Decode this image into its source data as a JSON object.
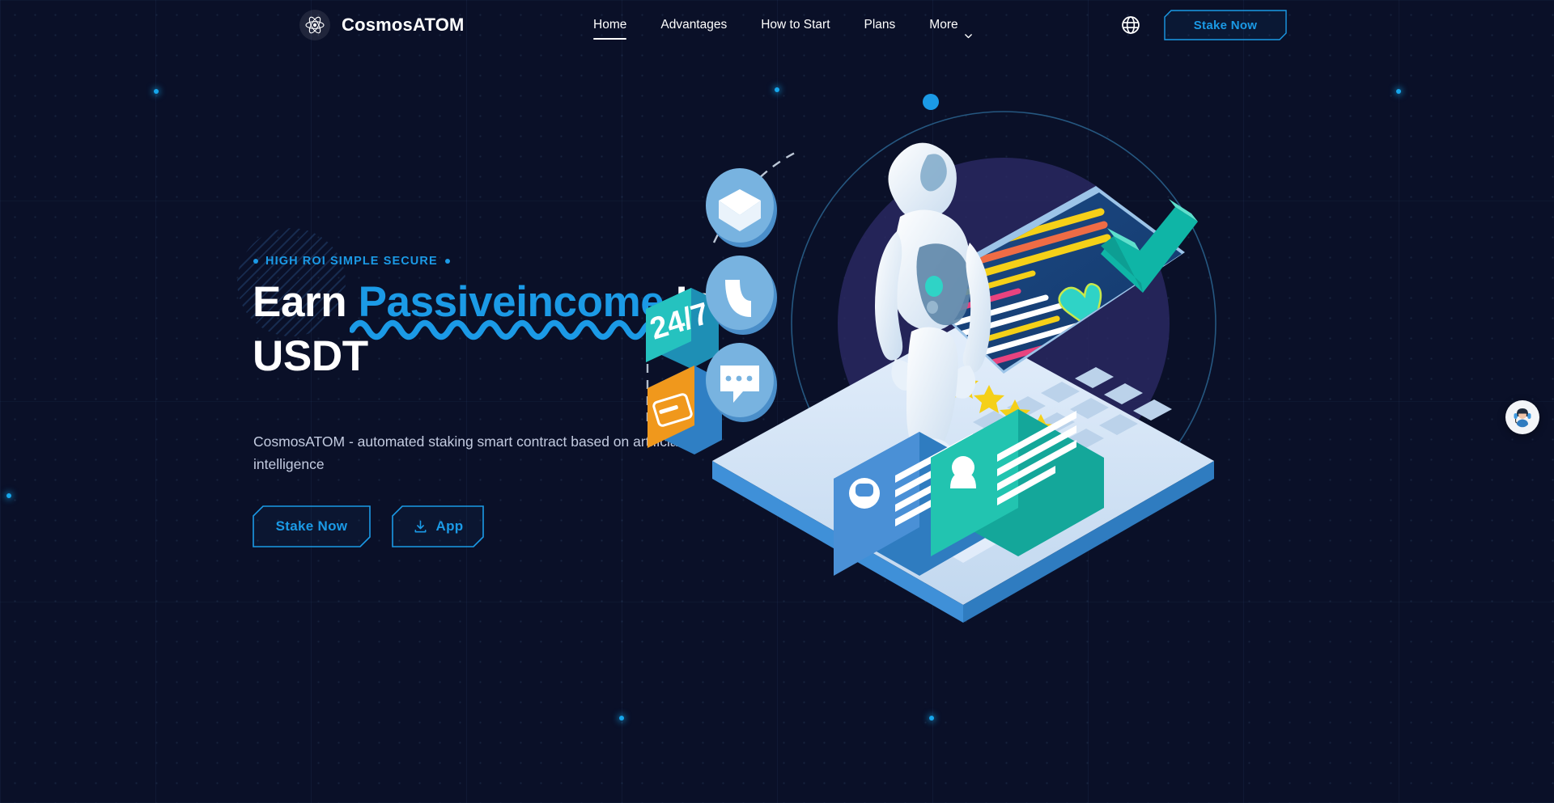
{
  "brand": {
    "name": "CosmosATOM",
    "logo_icon": "atom-icon"
  },
  "nav": {
    "items": [
      {
        "label": "Home",
        "active": true
      },
      {
        "label": "Advantages",
        "active": false
      },
      {
        "label": "How to Start",
        "active": false
      },
      {
        "label": "Plans",
        "active": false
      },
      {
        "label": "More",
        "active": false,
        "icon": "chevron-down-icon"
      }
    ]
  },
  "header": {
    "language_icon": "globe-icon",
    "stake_button": "Stake Now"
  },
  "hero": {
    "eyebrow": "HIGH ROI SIMPLE SECURE",
    "heading_part1": "Earn ",
    "heading_accent": "Passiveincome",
    "heading_part2": " In USDT",
    "subtitle": "CosmosATOM - automated staking smart contract based on artificial intelligence",
    "primary_button": "Stake Now",
    "secondary_button": "App",
    "secondary_button_icon": "download-icon"
  },
  "illustration": {
    "name": "ai-robot-laptop-illustration",
    "badge_label": "24/7",
    "elements": [
      "robot-figure",
      "laptop",
      "envelope-icon-disc",
      "phone-icon-disc",
      "chat-icon-disc",
      "credit-card-block",
      "checkmark-3d",
      "heart-icon",
      "star-rating",
      "bot-message-card",
      "user-message-card",
      "orbit-ring"
    ],
    "star_count": 5
  },
  "support_widget": {
    "icon": "support-agent-icon"
  },
  "colors": {
    "background": "#0a1028",
    "accent": "#1b9ae6",
    "text_primary": "#ffffff",
    "text_secondary": "#c3cbe0",
    "teal": "#22c4b0",
    "orange": "#f0981c",
    "yellow": "#f5d018"
  }
}
